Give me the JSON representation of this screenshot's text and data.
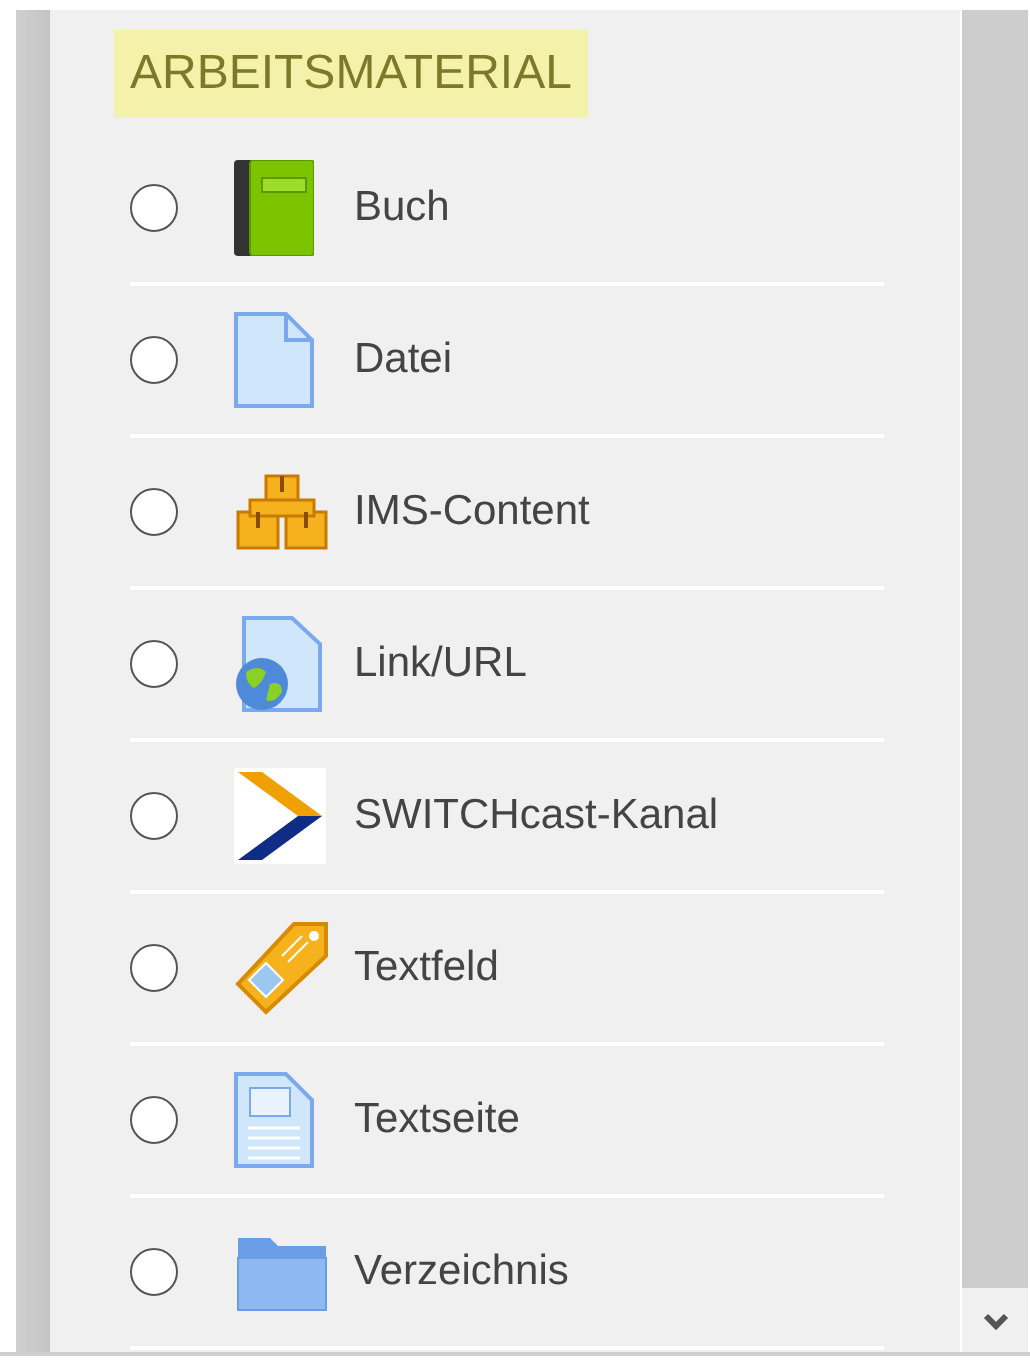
{
  "section": {
    "title": "ARBEITSMATERIAL"
  },
  "items": [
    {
      "kind": "book",
      "label": "Buch",
      "selected": false
    },
    {
      "kind": "file",
      "label": "Datei",
      "selected": false
    },
    {
      "kind": "boxes",
      "label": "IMS-Content",
      "selected": false
    },
    {
      "kind": "url",
      "label": "Link/URL",
      "selected": false
    },
    {
      "kind": "switchcast",
      "label": "SWITCHcast-Kanal",
      "selected": false
    },
    {
      "kind": "tag",
      "label": "Textfeld",
      "selected": false
    },
    {
      "kind": "page",
      "label": "Textseite",
      "selected": false
    },
    {
      "kind": "folder",
      "label": "Verzeichnis",
      "selected": false
    }
  ]
}
